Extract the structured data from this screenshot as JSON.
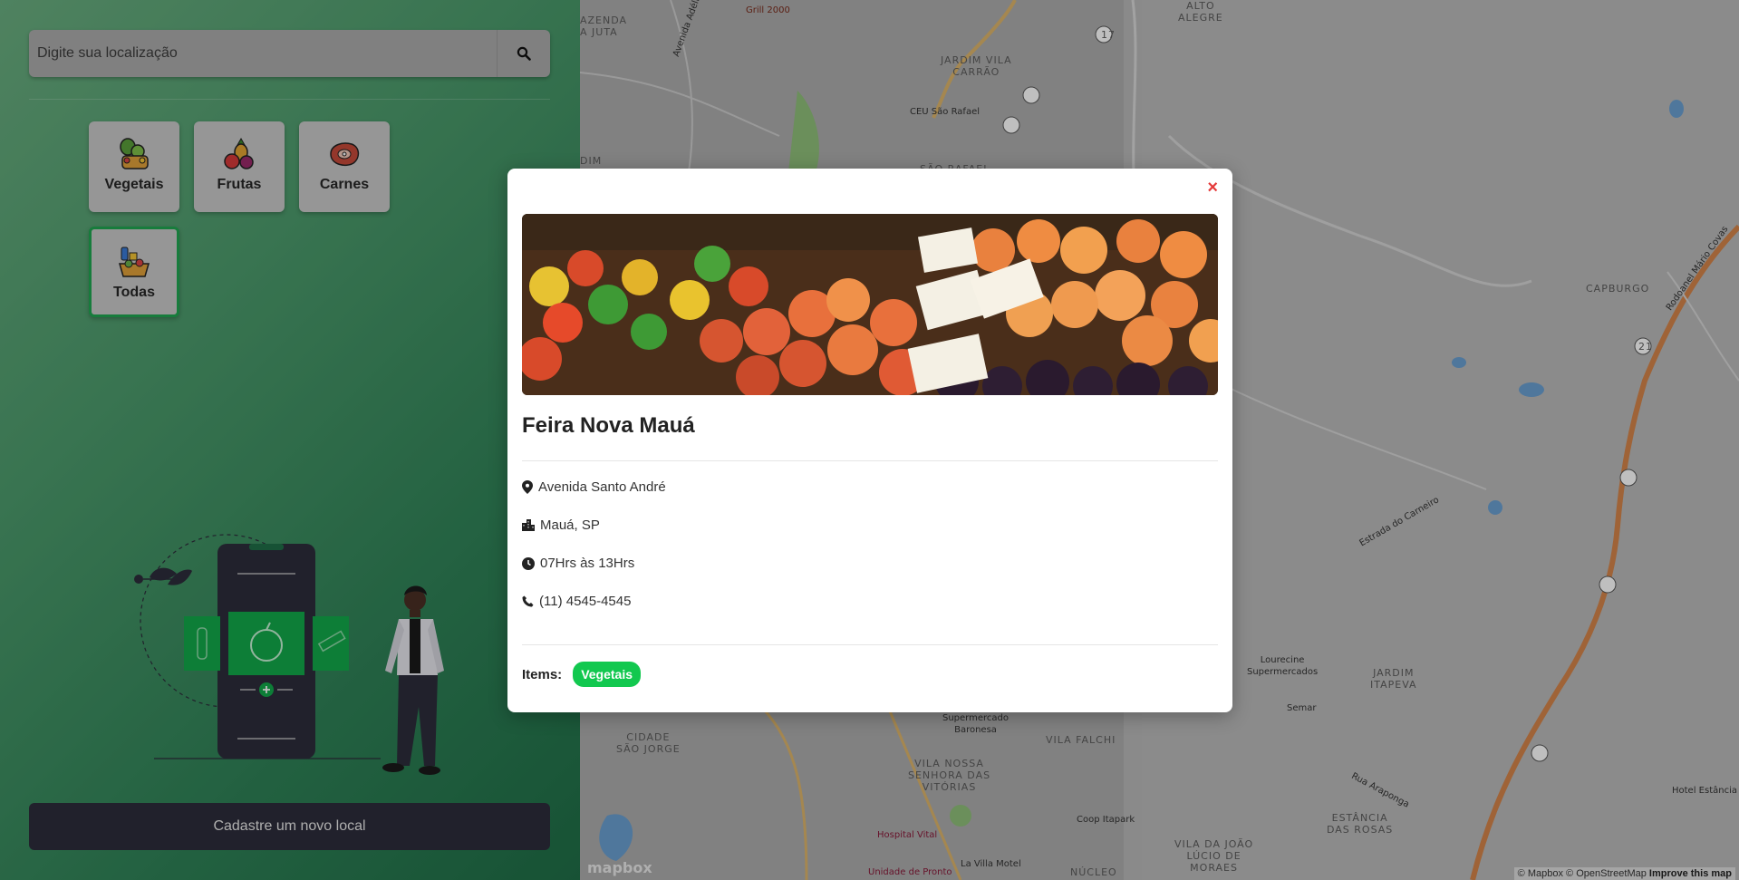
{
  "search": {
    "placeholder": "Digite sua localização",
    "icon": "search-icon"
  },
  "categories": [
    {
      "label": "Vegetais",
      "icon": "vegetables-icon",
      "active": false
    },
    {
      "label": "Frutas",
      "icon": "fruits-icon",
      "active": false
    },
    {
      "label": "Carnes",
      "icon": "meat-icon",
      "active": false
    },
    {
      "label": "Todas",
      "icon": "all-items-icon",
      "active": true
    }
  ],
  "register_button": {
    "label": "Cadastre um novo local"
  },
  "map": {
    "labels": {
      "azenda": "AZENDA\nA JUTA",
      "grill": "Grill 2000",
      "alto_alegre": "ALTO\nALEGRE",
      "jardim_vila_carrao": "JARDIM VILA\nCARRÃO",
      "ceu": "CEU São Rafael",
      "sao_rafael": "SÃO RAFAEL",
      "avenida": "Avenida Adélia Chohfi",
      "dim": "DIM",
      "capburgo": "CAPBURGO",
      "rodoanel": "Rodoanel Mário Covas",
      "estrada": "Estrada do Carneiro",
      "lourecine": "Lourecine\nSupermercados",
      "semar": "Semar",
      "jardim_itapeva": "JARDIM\nITAPEVA",
      "supermercado_baronesa": "Supermercado\nBaronesa",
      "cidade_sao_jorge": "CIDADE\nSÃO JORGE",
      "vila_falchi": "VILA FALCHI",
      "vila_nossa": "VILA NOSSA\nSENHORA DAS\nVITÓRIAS",
      "coop": "Coop Itapark",
      "rua_araponga": "Rua Araponga",
      "estancia": "ESTÂNCIA\nDAS ROSAS",
      "hotel": "Hotel Estância",
      "hospital": "Hospital Vital",
      "unidade": "Unidade de Pronto",
      "la_villa": "La Villa Motel",
      "nucleo": "NÚCLEO",
      "vila_da_joao": "VILA DA JOÃO\nLÚCIO DE\nMORAES"
    },
    "route_numbers": {
      "r17": "17",
      "r21": "21"
    },
    "mapbox": "mapbox",
    "attribution": {
      "mapbox": "© Mapbox",
      "osm": "© OpenStreetMap",
      "improve": "Improve this map"
    }
  },
  "modal": {
    "close": "×",
    "title": "Feira Nova Mauá",
    "address": "Avenida Santo André",
    "city": "Mauá, SP",
    "hours": "07Hrs às 13Hrs",
    "phone": "(11) 4545-4545",
    "items_label": "Items:",
    "items": [
      "Vegetais"
    ]
  },
  "colors": {
    "accent": "#12c84f",
    "close": "#e53a3a",
    "dark": "#2d2d3b"
  }
}
